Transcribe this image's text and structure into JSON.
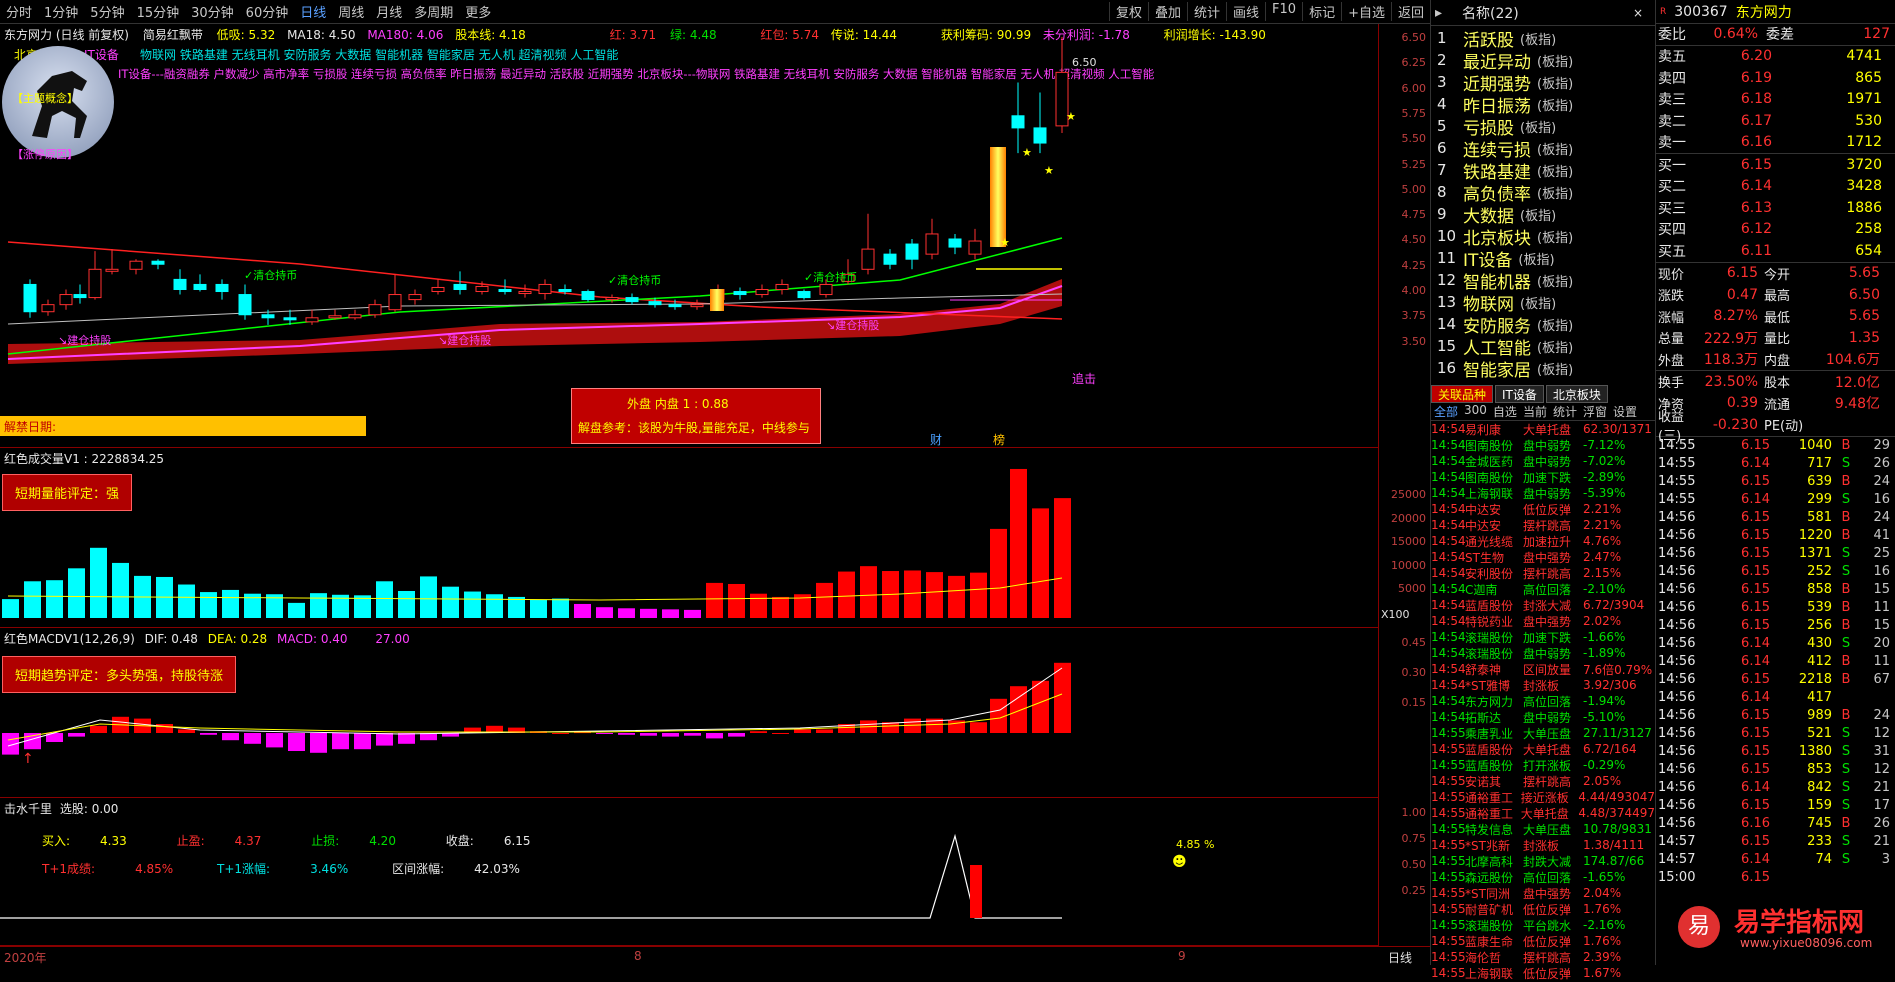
{
  "toolbar": {
    "periods": [
      "分时",
      "1分钟",
      "5分钟",
      "15分钟",
      "30分钟",
      "60分钟",
      "日线",
      "周线",
      "月线",
      "多周期",
      "更多"
    ],
    "active": "日线",
    "right": [
      "复权",
      "叠加",
      "统计",
      "画线",
      "F10",
      "标记",
      "+自选",
      "返回"
    ]
  },
  "main": {
    "title": "东方网力 (日线 前复权)",
    "indicator": "简易红飘带",
    "stats": {
      "low": "低吸: 5.32",
      "ma18": "MA18: 4.50",
      "ma180": "MA180: 4.06",
      "hf": "股本线: 4.18",
      "hong": "红: 3.71",
      "lv": "绿: 4.48",
      "hongbao": "红包: 5.74",
      "chuanshuo": "传说: 14.44",
      "huoli": "获利筹码: 90.99",
      "weifen": "未分利润: -1.78",
      "lirun": "利润增长: -143.90"
    },
    "concepts1": "物联网 铁路基建 无线耳机 安防服务 大数据 智能机器 智能家居 无人机 超清视频 人工智能",
    "concepts2": "IT设备---融资融券 户数减少 高市净率 亏损股 连续亏损 高负债率 昨日振荡 最近异动 活跃股 近期强势 北京板块---物联网 铁路基建 无线耳机 安防服务 大数据 智能机器 智能家居 无人机 超清视频 人工智能",
    "tag1": "北京板块",
    "tag2": "IT设备",
    "tag3": "【主题概念】",
    "tag4": "【涨停原因】",
    "price_label": "6.50",
    "yticks": [
      "6.50",
      "6.25",
      "6.00",
      "5.75",
      "5.50",
      "5.25",
      "5.00",
      "4.75",
      "4.50",
      "4.25",
      "4.00",
      "3.75",
      "3.50"
    ],
    "signals": [
      "✓清仓持币",
      "✓清仓持币",
      "✓清仓持币",
      "↘建仓持股",
      "↘建仓持股",
      "↘建仓持股"
    ],
    "zhuiji": "追击",
    "jiejin": "解禁日期:",
    "neipan": "外盘   内盘  1  :  0.88",
    "jiepan": "解盘参考：该股为牛股,量能充足，中线参与",
    "cai": "财",
    "bang": "榜"
  },
  "vol": {
    "title": "红色成交量V1 : 2228834.25",
    "box": "短期量能评定：强",
    "yticks": [
      "25000",
      "20000",
      "15000",
      "10000",
      "5000"
    ],
    "unit": "X100"
  },
  "macd": {
    "title": "红色MACDV1(12,26,9)",
    "dif": "DIF: 0.48",
    "dea": "DEA: 0.28",
    "macd": "MACD: 0.40",
    "val": "27.00",
    "box": "短期趋势评定：多头势强，持股待涨",
    "yticks": [
      "0.45",
      "0.30",
      "0.15"
    ]
  },
  "jsq": {
    "title": "击水千里",
    "pick": "选股: 0.00",
    "buy_l": "买入:",
    "buy_v": "4.33",
    "stop_l": "止盈:",
    "stop_v": "4.37",
    "loss_l": "止损:",
    "loss_v": "4.20",
    "close_l": "收盘:",
    "close_v": "6.15",
    "t1_l": "T+1成绩:",
    "t1_v": "4.85%",
    "t1z_l": "T+1涨幅:",
    "t1z_v": "3.46%",
    "qj_l": "区间涨幅:",
    "qj_v": "42.03%",
    "peak": "4.85 %",
    "yticks": [
      "1.00",
      "0.75",
      "0.50",
      "0.25"
    ]
  },
  "xaxis": {
    "labels": [
      "2020年",
      "8",
      "9"
    ],
    "right": "日线"
  },
  "sidebar": {
    "header": "名称(22)",
    "sectors": [
      {
        "n": "1",
        "name": "活跃股"
      },
      {
        "n": "2",
        "name": "最近异动"
      },
      {
        "n": "3",
        "name": "近期强势"
      },
      {
        "n": "4",
        "name": "昨日振荡"
      },
      {
        "n": "5",
        "name": "亏损股"
      },
      {
        "n": "6",
        "name": "连续亏损"
      },
      {
        "n": "7",
        "name": "铁路基建"
      },
      {
        "n": "8",
        "name": "高负债率"
      },
      {
        "n": "9",
        "name": "大数据"
      },
      {
        "n": "10",
        "name": "北京板块"
      },
      {
        "n": "11",
        "name": "IT设备"
      },
      {
        "n": "12",
        "name": "智能机器"
      },
      {
        "n": "13",
        "name": "物联网"
      },
      {
        "n": "14",
        "name": "安防服务"
      },
      {
        "n": "15",
        "name": "人工智能"
      },
      {
        "n": "16",
        "name": "智能家居"
      }
    ],
    "tag": "(板指)",
    "tabs": [
      "关联品种",
      "IT设备",
      "北京板块"
    ],
    "subtabs": [
      "全部",
      "300",
      "自选",
      "当前",
      "统计",
      "浮窗",
      "设置"
    ],
    "feed": [
      [
        "14:54",
        "易利康",
        "大单托盘",
        "62.30/1371",
        "r"
      ],
      [
        "14:54",
        "图南股份",
        "盘中弱势",
        "-7.12%",
        "g"
      ],
      [
        "14:54",
        "金城医药",
        "盘中弱势",
        "-7.02%",
        "g"
      ],
      [
        "14:54",
        "图南股份",
        "加速下跌",
        "-2.89%",
        "g"
      ],
      [
        "14:54",
        "上海钢联",
        "盘中弱势",
        "-5.39%",
        "g"
      ],
      [
        "14:54",
        "中达安",
        "低位反弹",
        "2.21%",
        "r"
      ],
      [
        "14:54",
        "中达安",
        "摆杆跳高",
        "2.21%",
        "r"
      ],
      [
        "14:54",
        "通光线缆",
        "加速拉升",
        "4.76%",
        "r"
      ],
      [
        "14:54",
        "ST生物",
        "盘中强势",
        "2.47%",
        "r"
      ],
      [
        "14:54",
        "安利股份",
        "摆杆跳高",
        "2.15%",
        "r"
      ],
      [
        "14:54",
        "C迦南",
        "高位回落",
        "-2.10%",
        "g"
      ],
      [
        "14:54",
        "蓝盾股份",
        "封涨大减",
        "6.72/3904",
        "r"
      ],
      [
        "14:54",
        "特锐药业",
        "盘中强势",
        "2.02%",
        "r"
      ],
      [
        "14:54",
        "滚瑞股份",
        "加速下跌",
        "-1.66%",
        "g"
      ],
      [
        "14:54",
        "滚瑞股份",
        "盘中弱势",
        "-1.89%",
        "g"
      ],
      [
        "14:54",
        "舒泰神",
        "区间放量",
        "7.6倍0.79%",
        "r"
      ],
      [
        "14:54",
        "*ST雅博",
        "封涨板",
        "3.92/306",
        "r"
      ],
      [
        "14:54",
        "东方网力",
        "高位回落",
        "-1.94%",
        "g"
      ],
      [
        "14:54",
        "拓斯达",
        "盘中弱势",
        "-5.10%",
        "g"
      ],
      [
        "14:55",
        "乘唐乳业",
        "大单压盘",
        "27.11/3127",
        "g"
      ],
      [
        "14:55",
        "蓝盾股份",
        "大单托盘",
        "6.72/164",
        "r"
      ],
      [
        "14:55",
        "蓝盾股份",
        "打开涨板",
        "-0.29%",
        "g"
      ],
      [
        "14:55",
        "安诺其",
        "摆杆跳高",
        "2.05%",
        "r"
      ],
      [
        "14:55",
        "通裕重工",
        "接近涨板",
        "4.44/493047",
        "r"
      ],
      [
        "14:55",
        "通裕重工",
        "大单托盘",
        "4.48/374497",
        "r"
      ],
      [
        "14:55",
        "特发信息",
        "大单压盘",
        "10.78/9831",
        "g"
      ],
      [
        "14:55",
        "*ST兆新",
        "封涨板",
        "1.38/4111",
        "r"
      ],
      [
        "14:55",
        "北摩高科",
        "封跌大减",
        "174.87/66",
        "g"
      ],
      [
        "14:55",
        "森远股份",
        "高位回落",
        "-1.65%",
        "g"
      ],
      [
        "14:55",
        "*ST同洲",
        "盘中强势",
        "2.04%",
        "r"
      ],
      [
        "14:55",
        "耐普矿机",
        "低位反弹",
        "1.76%",
        "r"
      ],
      [
        "14:55",
        "滚瑞股份",
        "平台跳水",
        "-2.16%",
        "g"
      ],
      [
        "14:55",
        "蓝康生命",
        "低位反弹",
        "1.76%",
        "r"
      ],
      [
        "14:55",
        "海伦哲",
        "摆杆跳高",
        "2.39%",
        "r"
      ],
      [
        "14:55",
        "上海钢联",
        "低位反弹",
        "1.67%",
        "r"
      ]
    ]
  },
  "quote": {
    "code": "300367",
    "name": "东方网力",
    "weibi_l": "委比",
    "weibi_v": "0.64%",
    "weicha_l": "委差",
    "weicha_v": "127",
    "asks": [
      [
        "卖五",
        "6.20",
        "4741"
      ],
      [
        "卖四",
        "6.19",
        "865"
      ],
      [
        "卖三",
        "6.18",
        "1971"
      ],
      [
        "卖二",
        "6.17",
        "530"
      ],
      [
        "卖一",
        "6.16",
        "1712"
      ]
    ],
    "bids": [
      [
        "买一",
        "6.15",
        "3720"
      ],
      [
        "买二",
        "6.14",
        "3428"
      ],
      [
        "买三",
        "6.13",
        "1886"
      ],
      [
        "买四",
        "6.12",
        "258"
      ],
      [
        "买五",
        "6.11",
        "654"
      ]
    ],
    "stats": [
      [
        "现价",
        "6.15",
        "今开",
        "5.65"
      ],
      [
        "涨跌",
        "0.47",
        "最高",
        "6.50"
      ],
      [
        "涨幅",
        "8.27%",
        "最低",
        "5.65"
      ],
      [
        "总量",
        "222.9万",
        "量比",
        "1.35"
      ],
      [
        "外盘",
        "118.3万",
        "内盘",
        "104.6万"
      ]
    ],
    "stats2": [
      [
        "换手",
        "23.50%",
        "股本",
        "12.0亿"
      ],
      [
        "净资",
        "0.39",
        "流通",
        "9.48亿"
      ],
      [
        "收益(三)",
        "-0.230",
        "PE(动)",
        ""
      ]
    ],
    "ticks": [
      [
        "14:55",
        "6.15",
        "1040",
        "B",
        "29"
      ],
      [
        "14:55",
        "6.14",
        "717",
        "S",
        "26"
      ],
      [
        "14:55",
        "6.15",
        "639",
        "B",
        "24"
      ],
      [
        "14:55",
        "6.14",
        "299",
        "S",
        "16"
      ],
      [
        "14:56",
        "6.15",
        "581",
        "B",
        "24"
      ],
      [
        "14:56",
        "6.15",
        "1220",
        "B",
        "41"
      ],
      [
        "14:56",
        "6.15",
        "1371",
        "S",
        "25"
      ],
      [
        "14:56",
        "6.15",
        "252",
        "S",
        "16"
      ],
      [
        "14:56",
        "6.15",
        "858",
        "B",
        "15"
      ],
      [
        "14:56",
        "6.15",
        "539",
        "B",
        "11"
      ],
      [
        "14:56",
        "6.15",
        "256",
        "B",
        "15"
      ],
      [
        "14:56",
        "6.14",
        "430",
        "S",
        "20"
      ],
      [
        "14:56",
        "6.14",
        "412",
        "B",
        "11"
      ],
      [
        "14:56",
        "6.15",
        "2218",
        "B",
        "67"
      ],
      [
        "14:56",
        "6.14",
        "417",
        "",
        ""
      ],
      [
        "14:56",
        "6.15",
        "989",
        "B",
        "24"
      ],
      [
        "14:56",
        "6.15",
        "521",
        "S",
        "12"
      ],
      [
        "14:56",
        "6.15",
        "1380",
        "S",
        "31"
      ],
      [
        "14:56",
        "6.15",
        "853",
        "S",
        "12"
      ],
      [
        "14:56",
        "6.14",
        "842",
        "S",
        "21"
      ],
      [
        "14:56",
        "6.15",
        "159",
        "S",
        "17"
      ],
      [
        "14:56",
        "6.16",
        "745",
        "B",
        "26"
      ],
      [
        "14:57",
        "6.15",
        "233",
        "S",
        "21"
      ],
      [
        "14:57",
        "6.14",
        "74",
        "S",
        "3"
      ],
      [
        "15:00",
        "6.15",
        "",
        "",
        ""
      ]
    ]
  },
  "watermark": {
    "text": "易学指标网",
    "url": "www.yixue08096.com"
  }
}
